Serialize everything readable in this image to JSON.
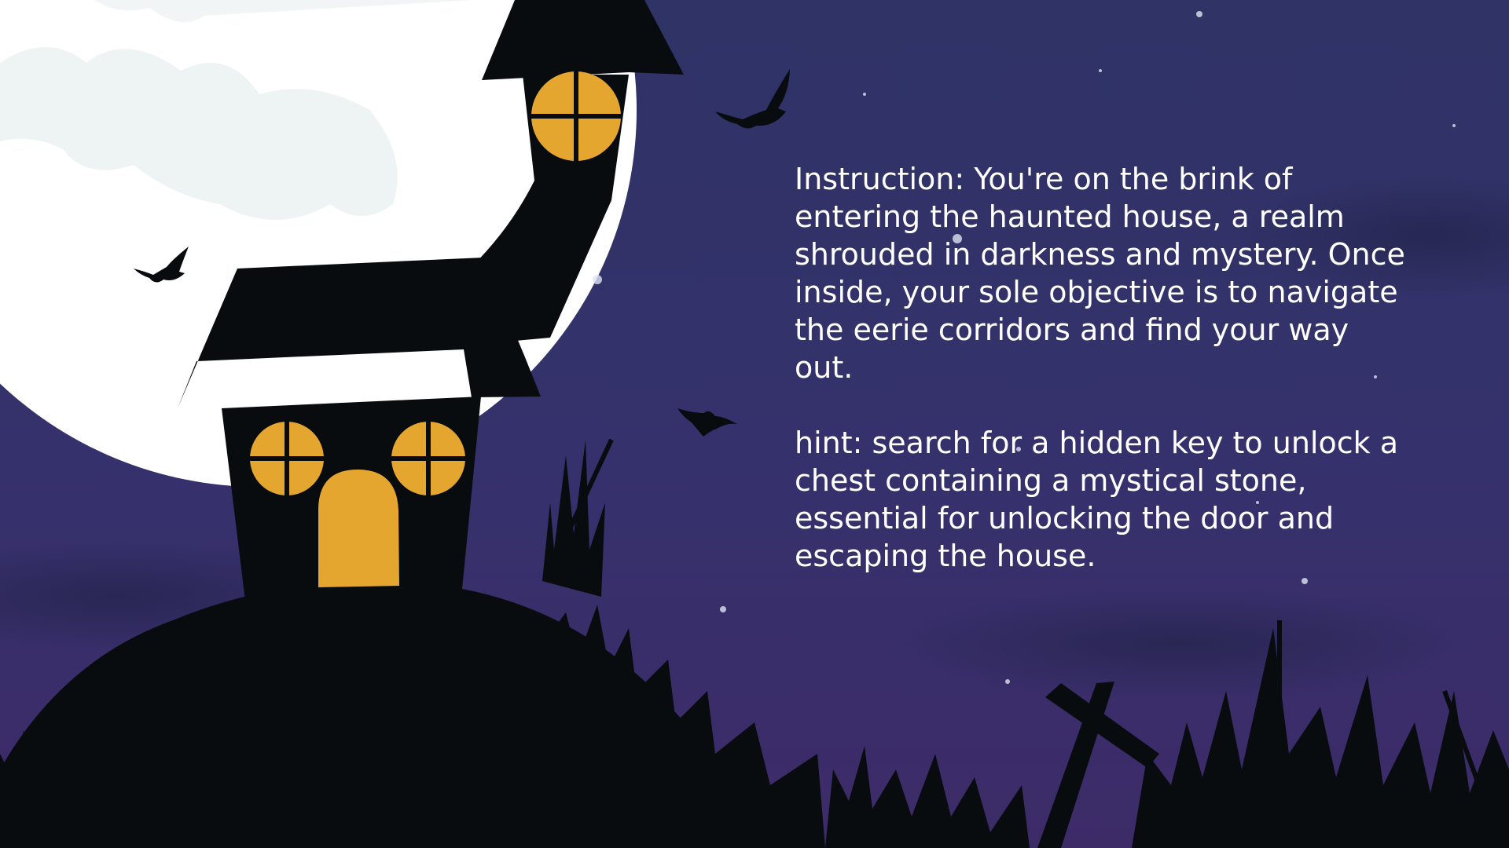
{
  "scene": {
    "colors": {
      "sky_top": "#313467",
      "sky_bottom": "#3b2d6a",
      "moon": "#ffffff",
      "moon_shadow": "#eef3f3",
      "silhouette": "#080c0f",
      "window_light": "#e5a630"
    },
    "icons": [
      "moon",
      "haunted-house",
      "bat",
      "grave-cross",
      "grass",
      "star"
    ]
  },
  "instruction": {
    "text": "Instruction: You're on the brink of entering the haunted house, a realm shrouded in darkness and mystery. Once inside, your sole objective is to navigate the eerie corridors and find your way out."
  },
  "hint": {
    "text": "hint: search for a hidden key to unlock a chest containing a mystical stone, essential for unlocking the door and escaping the house."
  }
}
